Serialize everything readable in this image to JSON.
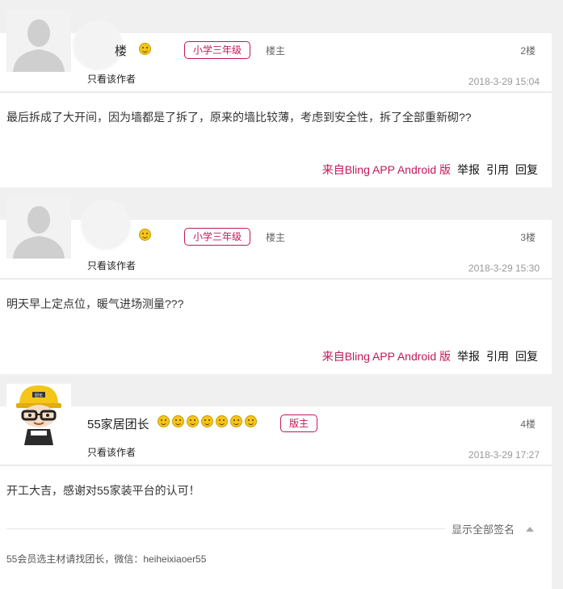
{
  "posts": [
    {
      "username_visible": "楼",
      "level_badge": "小学三年级",
      "role_label": "楼主",
      "floor": "2楼",
      "only_author": "只看该作者",
      "timestamp": "2018-3-29 15:04",
      "content": "最后拆成了大开间，因为墙都是了拆了，原来的墙比较薄，考虑到安全性，拆了全部重新砌??",
      "source": "来自Bling APP Android 版",
      "actions": [
        "举报",
        "引用",
        "回复"
      ]
    },
    {
      "username_visible": "",
      "level_badge": "小学三年级",
      "role_label": "楼主",
      "floor": "3楼",
      "only_author": "只看该作者",
      "timestamp": "2018-3-29 15:30",
      "content": "明天早上定点位，暖气进场测量???",
      "source": "来自Bling APP Android 版",
      "actions": [
        "举报",
        "引用",
        "回复"
      ]
    },
    {
      "username": "55家居团长",
      "level_badge": "版主",
      "floor": "4楼",
      "only_author": "只看该作者",
      "timestamp": "2018-3-29 17:27",
      "content": "开工大吉，感谢对55家装平台的认可！",
      "show_signature": "显示全部签名",
      "signature": "55会员选主材请找团长，微信：heiheixiaoer55",
      "avatar_helmet_text": "团长"
    }
  ],
  "colors": {
    "accent": "#c2185b",
    "background": "#f0f0f0",
    "helmet": "#f5c518"
  }
}
